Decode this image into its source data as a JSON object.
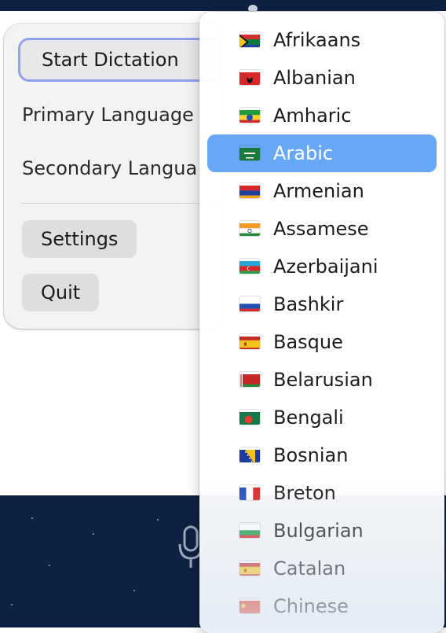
{
  "menu": {
    "start_dictation": "Start Dictation",
    "primary_language": "Primary Language",
    "secondary_language": "Secondary Langua",
    "settings": "Settings",
    "quit": "Quit"
  },
  "language_dropdown": {
    "selected": "Arabic",
    "items": [
      {
        "label": "Afrikaans",
        "flag": "south-africa-flag"
      },
      {
        "label": "Albanian",
        "flag": "albania-flag"
      },
      {
        "label": "Amharic",
        "flag": "ethiopia-flag"
      },
      {
        "label": "Arabic",
        "flag": "saudi-arabia-flag"
      },
      {
        "label": "Armenian",
        "flag": "armenia-flag"
      },
      {
        "label": "Assamese",
        "flag": "india-flag"
      },
      {
        "label": "Azerbaijani",
        "flag": "azerbaijan-flag"
      },
      {
        "label": "Bashkir",
        "flag": "russia-flag"
      },
      {
        "label": "Basque",
        "flag": "spain-flag"
      },
      {
        "label": "Belarusian",
        "flag": "belarus-flag"
      },
      {
        "label": "Bengali",
        "flag": "bangladesh-flag"
      },
      {
        "label": "Bosnian",
        "flag": "bosnia-flag"
      },
      {
        "label": "Breton",
        "flag": "france-flag"
      },
      {
        "label": "Bulgarian",
        "flag": "bulgaria-flag"
      },
      {
        "label": "Catalan",
        "flag": "spain-flag"
      },
      {
        "label": "Chinese",
        "flag": "china-flag"
      }
    ]
  },
  "colors": {
    "selection": "#66a8f5",
    "focus_ring": "#8ea2ee",
    "app_background": "#0f2142"
  }
}
